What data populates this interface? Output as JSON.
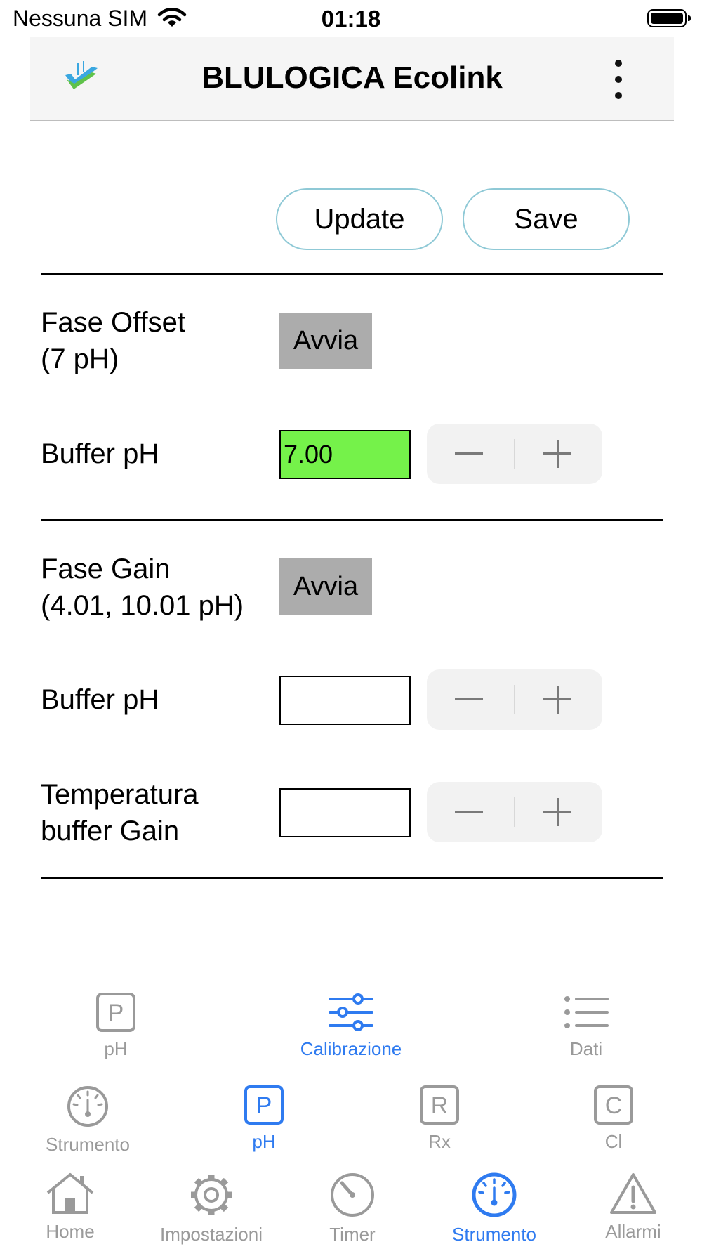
{
  "status_bar": {
    "carrier": "Nessuna SIM",
    "time": "01:18"
  },
  "header": {
    "title": "BLULOGICA Ecolink"
  },
  "actions": {
    "update_label": "Update",
    "save_label": "Save"
  },
  "offset": {
    "title_line1": "Fase Offset",
    "title_line2": "(7 pH)",
    "start_label": "Avvia",
    "buffer_label": "Buffer pH",
    "buffer_value": "7.00"
  },
  "gain": {
    "title_line1": "Fase Gain",
    "title_line2": "(4.01, 10.01 pH)",
    "start_label": "Avvia",
    "buffer_label": "Buffer pH",
    "buffer_value": "",
    "temp_label_line1": "Temperatura",
    "temp_label_line2": "buffer Gain",
    "temp_value": ""
  },
  "subtabs": [
    {
      "label": "pH",
      "icon": "p-square-icon"
    },
    {
      "label": "Calibrazione",
      "icon": "sliders-icon",
      "active": true
    },
    {
      "label": "Dati",
      "icon": "list-icon"
    }
  ],
  "instrument_tabs": [
    {
      "label": "Strumento",
      "icon": "gauge-icon"
    },
    {
      "label": "pH",
      "icon": "p-square-icon",
      "active": true
    },
    {
      "label": "Rx",
      "icon": "r-square-icon"
    },
    {
      "label": "Cl",
      "icon": "c-square-icon"
    }
  ],
  "main_tabs": [
    {
      "label": "Home",
      "icon": "house-icon"
    },
    {
      "label": "Impostazioni",
      "icon": "gear-icon"
    },
    {
      "label": "Timer",
      "icon": "timer-icon"
    },
    {
      "label": "Strumento",
      "icon": "gauge-icon",
      "active": true
    },
    {
      "label": "Allarmi",
      "icon": "warning-icon"
    }
  ],
  "colors": {
    "accent": "#2f7bf0",
    "inactive": "#9a9a9a",
    "active_field": "#75f24a",
    "pill_border": "#8fc9d6"
  }
}
